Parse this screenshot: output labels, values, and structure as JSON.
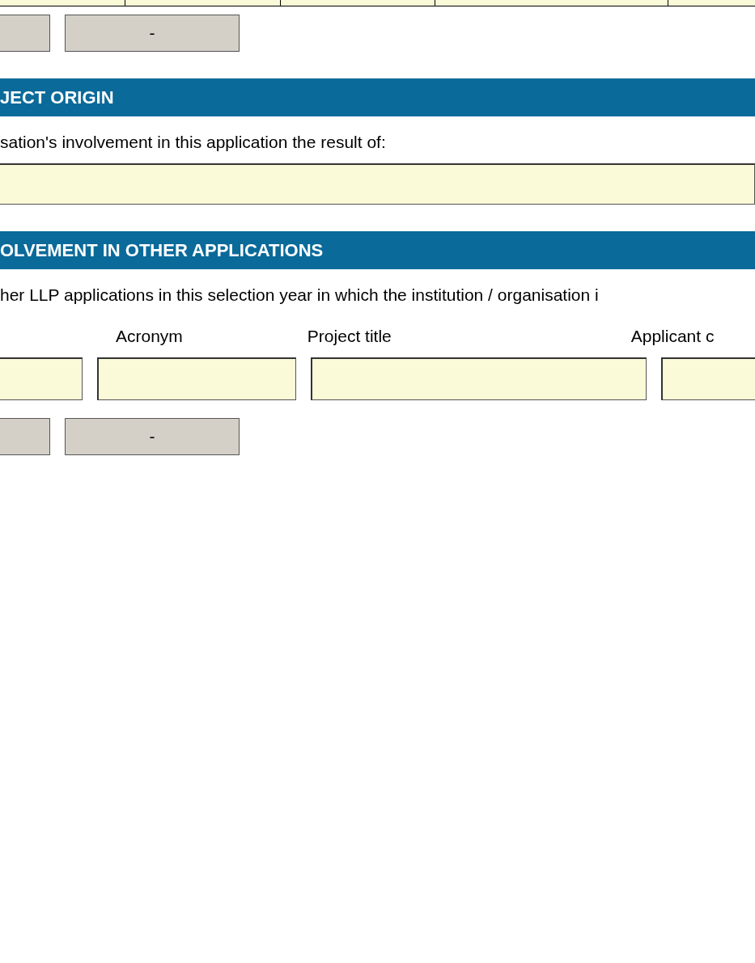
{
  "top_buttons": [
    {
      "kind": "add"
    },
    {
      "kind": "remove",
      "label": "-"
    }
  ],
  "sections": [
    {
      "title": "JECT ORIGIN",
      "question": "sation's involvement in this application the result of:",
      "kind": "single"
    },
    {
      "title": "OLVEMENT IN OTHER APPLICATIONS",
      "question": "her LLP applications in this selection year in which the institution / organisation i",
      "kind": "table",
      "columns": [
        "Acronym",
        "Project title",
        "Applicant c"
      ],
      "buttons": [
        {
          "kind": "add"
        },
        {
          "kind": "remove",
          "label": "-"
        }
      ]
    }
  ]
}
